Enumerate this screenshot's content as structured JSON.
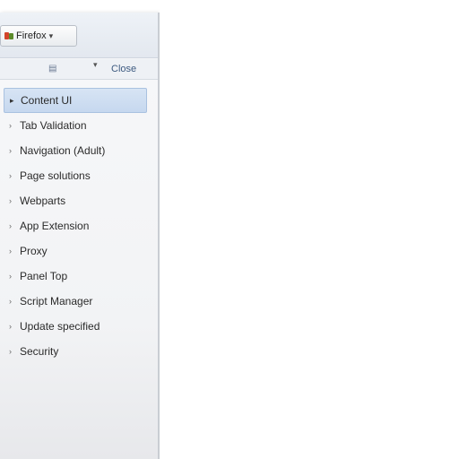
{
  "window": {
    "profile_label": "Firefox"
  },
  "toolbar": {
    "filter_icon": "filter-icon",
    "sort_icon": "sort-icon",
    "close_label": "Close"
  },
  "sidebar": {
    "items": [
      {
        "label": "Content UI",
        "selected": true
      },
      {
        "label": "Tab Validation",
        "selected": false
      },
      {
        "label": "Navigation (Adult)",
        "selected": false
      },
      {
        "label": "Page solutions",
        "selected": false
      },
      {
        "label": "Webparts",
        "selected": false
      },
      {
        "label": "App Extension",
        "selected": false
      },
      {
        "label": "Proxy",
        "selected": false
      },
      {
        "label": "Panel Top",
        "selected": false
      },
      {
        "label": "Script Manager",
        "selected": false
      },
      {
        "label": "Update specified",
        "selected": false
      },
      {
        "label": "Security",
        "selected": false
      }
    ]
  }
}
